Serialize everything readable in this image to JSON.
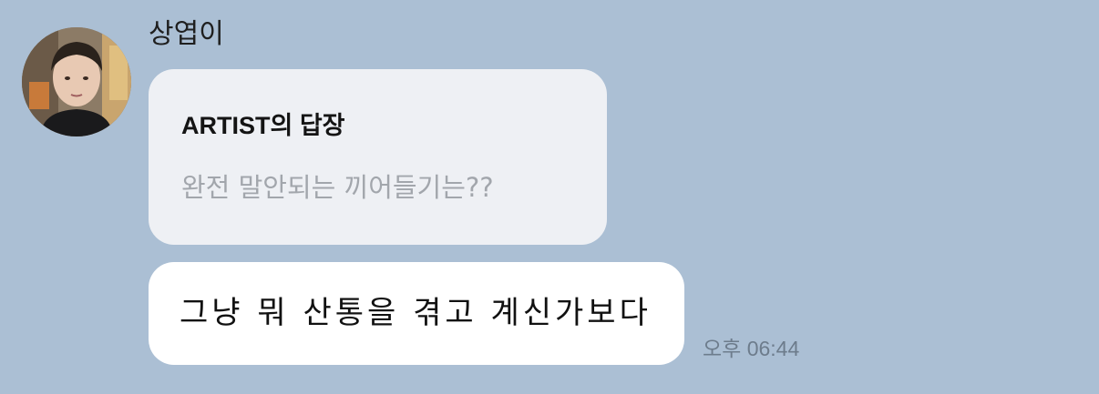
{
  "chat": {
    "sender_name": "상엽이",
    "avatar_icon": "profile-photo",
    "reply": {
      "title": "ARTIST의 답장",
      "quoted_text": "완전 말안되는 끼어들기는??"
    },
    "message": {
      "text": "그냥 뭐 산통을 겪고 계신가보다",
      "time": "오후 06:44"
    }
  },
  "colors": {
    "background": "#abbfd4",
    "reply_bubble": "#eef0f4",
    "message_bubble": "#ffffff",
    "quoted_text": "#a2a6ac",
    "timestamp": "#6d7c8c"
  }
}
